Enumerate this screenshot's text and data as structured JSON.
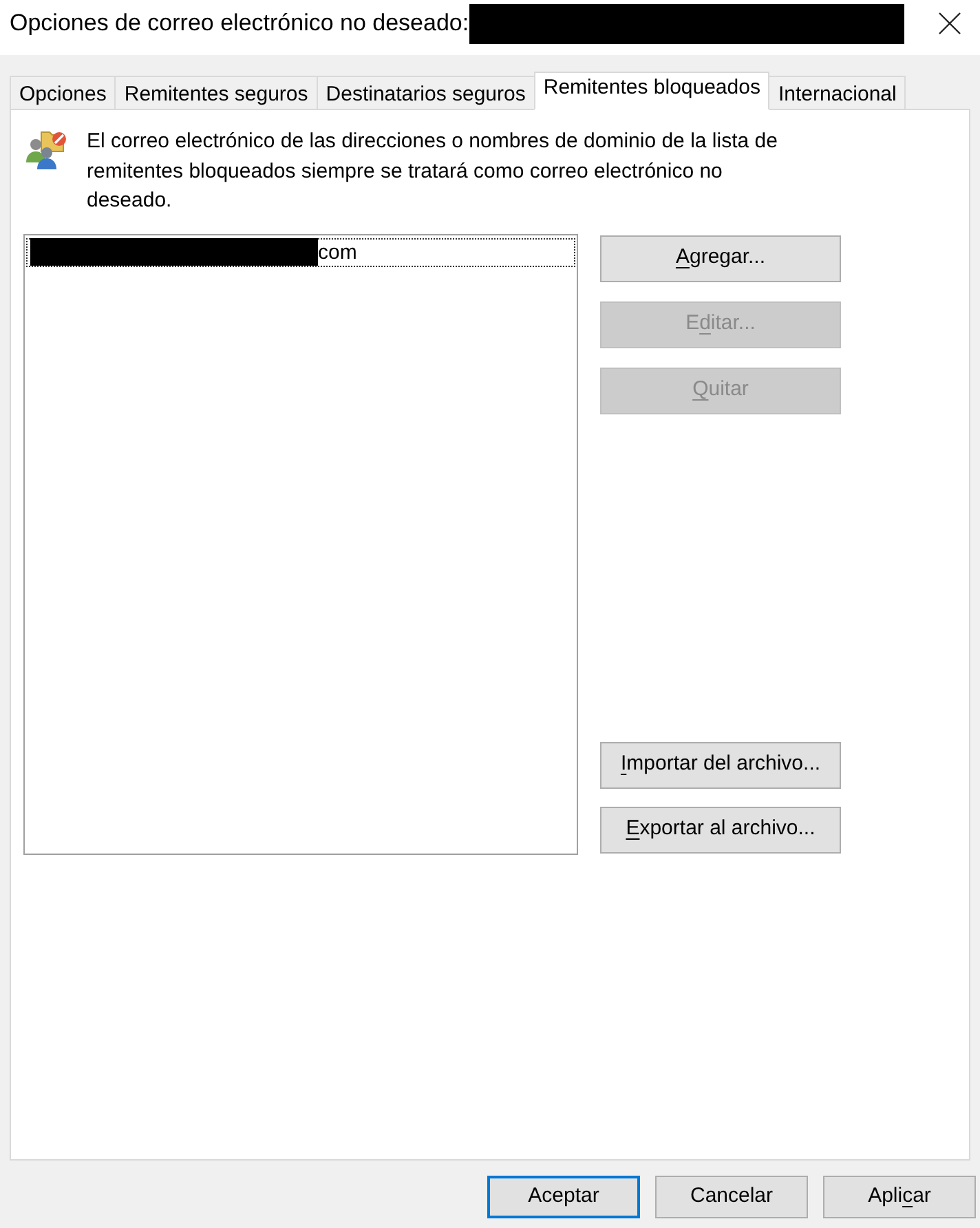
{
  "window": {
    "title": "Opciones de correo electrónico no deseado:",
    "title_redacted": true
  },
  "tabs": [
    {
      "label": "Opciones",
      "selected": false
    },
    {
      "label": "Remitentes seguros",
      "selected": false
    },
    {
      "label": "Destinatarios seguros",
      "selected": false
    },
    {
      "label": "Remitentes bloqueados",
      "selected": true
    },
    {
      "label": "Internacional",
      "selected": false
    }
  ],
  "description": "El correo electrónico de las direcciones o nombres de dominio de la lista de remitentes bloqueados siempre se tratará como correo electrónico no deseado.",
  "blocked_list": {
    "items": [
      {
        "text": "com",
        "redacted": true,
        "focused": true
      }
    ]
  },
  "action_buttons": [
    {
      "label_parts": [
        {
          "text": "A",
          "access_key": true
        },
        {
          "text": "gregar...",
          "access_key": false
        }
      ],
      "disabled": false
    },
    {
      "label_parts": [
        {
          "text": "E",
          "access_key": false
        },
        {
          "text": "d",
          "access_key": true
        },
        {
          "text": "itar...",
          "access_key": false
        }
      ],
      "disabled": true
    },
    {
      "label_parts": [
        {
          "text": "Q",
          "access_key": true
        },
        {
          "text": "uitar",
          "access_key": false
        }
      ],
      "disabled": true
    }
  ],
  "file_buttons": [
    {
      "label_parts": [
        {
          "text": "I",
          "access_key": true
        },
        {
          "text": "mportar del archivo...",
          "access_key": false
        }
      ],
      "disabled": false
    },
    {
      "label_parts": [
        {
          "text": "E",
          "access_key": true
        },
        {
          "text": "xportar al archivo...",
          "access_key": false
        }
      ],
      "disabled": false
    }
  ],
  "dialog_buttons": [
    {
      "label_parts": [
        {
          "text": "Aceptar",
          "access_key": false
        }
      ],
      "default": true
    },
    {
      "label_parts": [
        {
          "text": "Cancelar",
          "access_key": false
        }
      ],
      "default": false
    },
    {
      "label_parts": [
        {
          "text": "Apli",
          "access_key": false
        },
        {
          "text": "c",
          "access_key": true
        },
        {
          "text": "ar",
          "access_key": false
        }
      ],
      "default": false
    }
  ]
}
